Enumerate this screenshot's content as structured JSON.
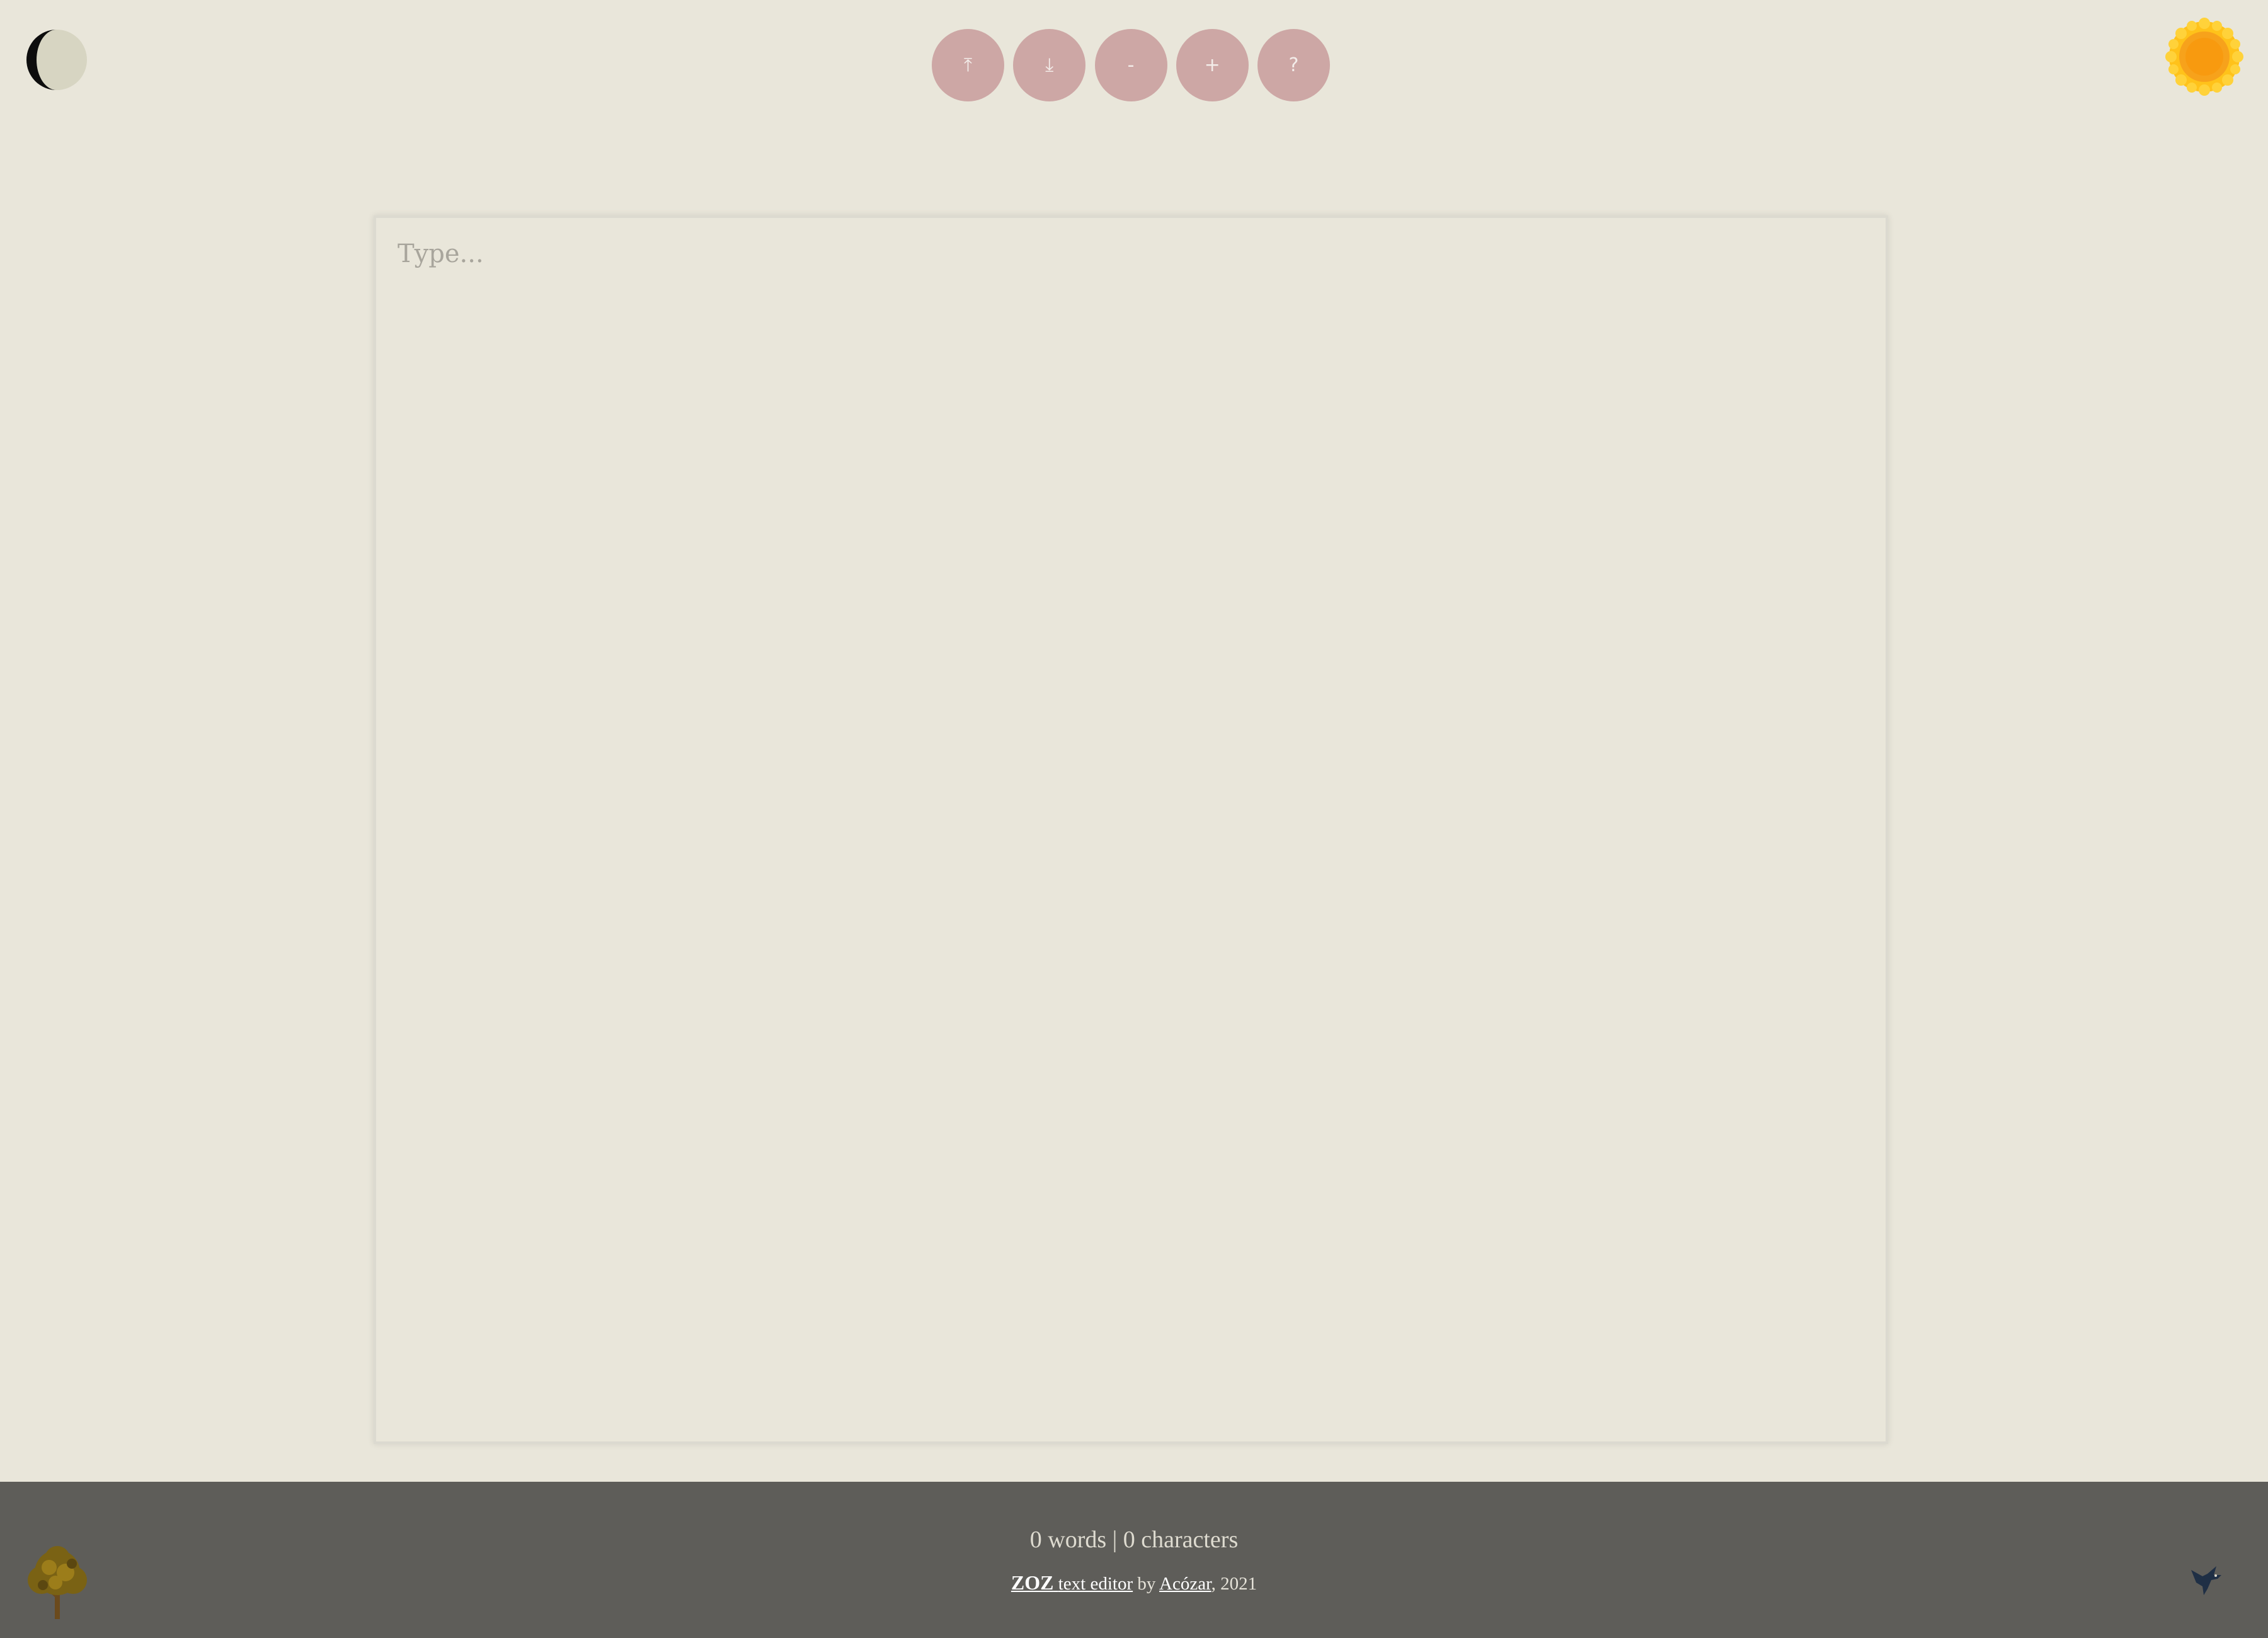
{
  "toolbar": {
    "buttons": [
      {
        "id": "upload",
        "label": "⤒",
        "icon": "upload-icon"
      },
      {
        "id": "download",
        "label": "⤓",
        "icon": "download-icon"
      },
      {
        "id": "decrease_font",
        "label": "-",
        "icon": "minus-icon"
      },
      {
        "id": "increase_font",
        "label": "+",
        "icon": "plus-icon"
      },
      {
        "id": "help",
        "label": "?",
        "icon": "help-icon"
      }
    ]
  },
  "icons": {
    "top_left": "moon-icon",
    "top_right": "sun-icon",
    "footer_left": "tree-icon",
    "footer_right": "bird-icon"
  },
  "editor": {
    "placeholder": "Type...",
    "value": ""
  },
  "footer": {
    "word_count": "0",
    "words_label": "words",
    "separator": "|",
    "char_count": "0",
    "chars_label": "characters",
    "brand_text": "ZOZ",
    "product_text": "text editor",
    "by_text": "by",
    "author_text": "Acózar",
    "year_text": ", 2021"
  },
  "colors": {
    "background": "#e9e6da",
    "button": "#cda7a5",
    "footer": "#5e5d59",
    "sun": "#f7a21b"
  }
}
